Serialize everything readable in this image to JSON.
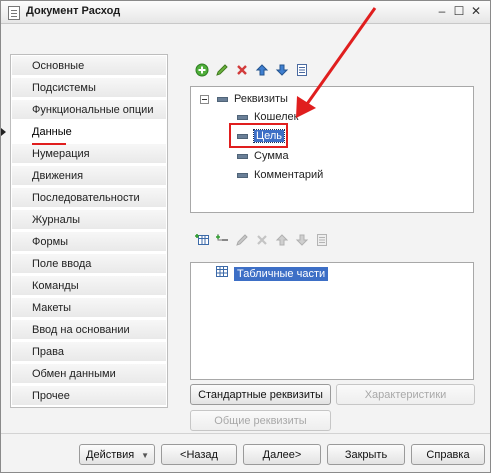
{
  "window": {
    "title": "Документ Расход"
  },
  "sidebar": {
    "items": [
      {
        "label": "Основные"
      },
      {
        "label": "Подсистемы"
      },
      {
        "label": "Функциональные опции"
      },
      {
        "label": "Данные",
        "active": true
      },
      {
        "label": "Нумерация"
      },
      {
        "label": "Движения"
      },
      {
        "label": "Последовательности"
      },
      {
        "label": "Журналы"
      },
      {
        "label": "Формы"
      },
      {
        "label": "Поле ввода"
      },
      {
        "label": "Команды"
      },
      {
        "label": "Макеты"
      },
      {
        "label": "Ввод на основании"
      },
      {
        "label": "Права"
      },
      {
        "label": "Обмен данными"
      },
      {
        "label": "Прочее"
      }
    ]
  },
  "attributes_tree": {
    "root": "Реквизиты",
    "children": [
      "Кошелек",
      "Цель",
      "Сумма",
      "Комментарий"
    ],
    "selected": "Цель"
  },
  "tabular_tree": {
    "root": "Табличные части"
  },
  "buttons": {
    "standard_attributes": "Стандартные реквизиты",
    "characteristics": "Характеристики",
    "common_attributes": "Общие реквизиты"
  },
  "footer": {
    "actions": "Действия",
    "back": "<Назад",
    "next": "Далее>",
    "close": "Закрыть",
    "help": "Справка"
  },
  "colors": {
    "annotation_red": "#e01e1e",
    "selection_blue": "#3d6fc6"
  }
}
